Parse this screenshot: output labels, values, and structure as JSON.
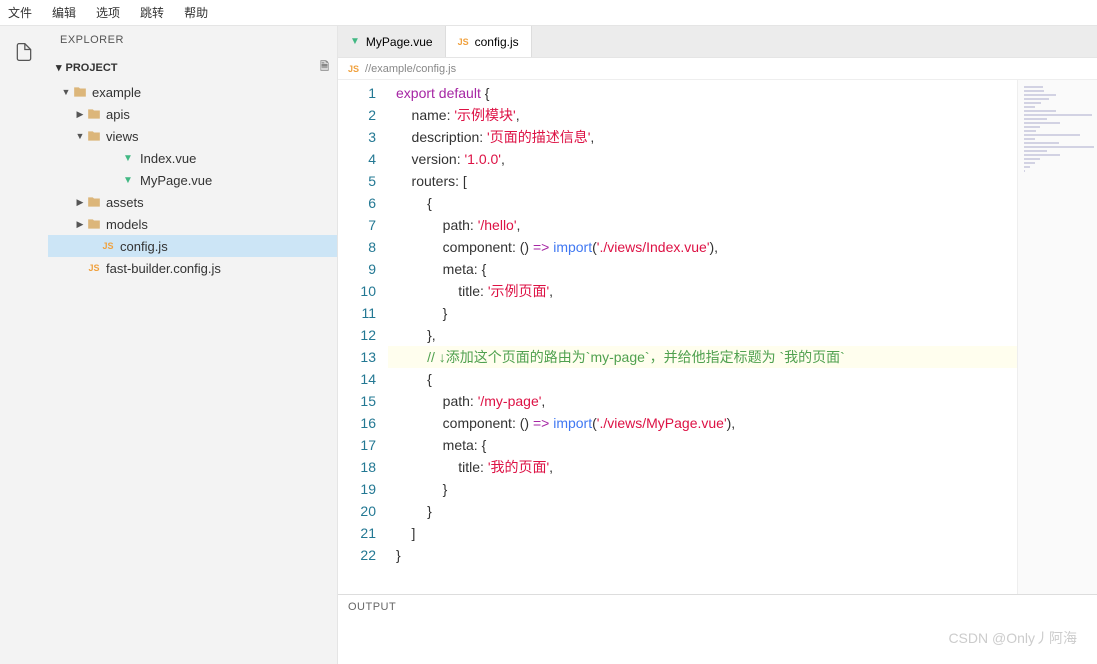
{
  "menubar": [
    "文件",
    "编辑",
    "选项",
    "跳转",
    "帮助"
  ],
  "sidebar": {
    "title": "EXPLORER",
    "project_label": "PROJECT",
    "tree": [
      {
        "label": "example",
        "indent": 0,
        "type": "folder",
        "expanded": true
      },
      {
        "label": "apis",
        "indent": 1,
        "type": "folder",
        "expanded": false
      },
      {
        "label": "views",
        "indent": 1,
        "type": "folder",
        "expanded": true
      },
      {
        "label": "Index.vue",
        "indent": 3,
        "type": "vue"
      },
      {
        "label": "MyPage.vue",
        "indent": 3,
        "type": "vue"
      },
      {
        "label": "assets",
        "indent": 1,
        "type": "folder",
        "expanded": false
      },
      {
        "label": "models",
        "indent": 1,
        "type": "folder",
        "expanded": false
      },
      {
        "label": "config.js",
        "indent": 2,
        "type": "js",
        "selected": true
      },
      {
        "label": "fast-builder.config.js",
        "indent": 1,
        "type": "js"
      }
    ]
  },
  "tabs": [
    {
      "label": "MyPage.vue",
      "icon": "vue",
      "active": false
    },
    {
      "label": "config.js",
      "icon": "js",
      "active": true
    }
  ],
  "breadcrumb": {
    "icon": "js",
    "path": "//example/config.js"
  },
  "code": {
    "lines": [
      [
        [
          "export default",
          "kw"
        ],
        [
          " {",
          "punc"
        ]
      ],
      [
        [
          "    name: ",
          "prop"
        ],
        [
          "'示例模块'",
          "str"
        ],
        [
          ",",
          "punc"
        ]
      ],
      [
        [
          "    description: ",
          "prop"
        ],
        [
          "'页面的描述信息'",
          "str"
        ],
        [
          ",",
          "punc"
        ]
      ],
      [
        [
          "    version: ",
          "prop"
        ],
        [
          "'1.0.0'",
          "str"
        ],
        [
          ",",
          "punc"
        ]
      ],
      [
        [
          "    routers: [",
          "prop"
        ]
      ],
      [
        [
          "        {",
          "punc"
        ]
      ],
      [
        [
          "            path: ",
          "prop"
        ],
        [
          "'/hello'",
          "str"
        ],
        [
          ",",
          "punc"
        ]
      ],
      [
        [
          "            component: ",
          "prop"
        ],
        [
          "()",
          "punc"
        ],
        [
          " => ",
          "kw"
        ],
        [
          "import",
          "fn"
        ],
        [
          "(",
          "punc"
        ],
        [
          "'./views/Index.vue'",
          "str"
        ],
        [
          "),",
          "punc"
        ]
      ],
      [
        [
          "            meta: {",
          "prop"
        ]
      ],
      [
        [
          "                title: ",
          "prop"
        ],
        [
          "'示例页面'",
          "str"
        ],
        [
          ",",
          "punc"
        ]
      ],
      [
        [
          "            }",
          "punc"
        ]
      ],
      [
        [
          "        },",
          "punc"
        ]
      ],
      [
        [
          "        // ↓添加这个页面的路由为`my-page`，并给他指定标题为 `我的页面`",
          "com"
        ]
      ],
      [
        [
          "        {",
          "punc"
        ]
      ],
      [
        [
          "            path: ",
          "prop"
        ],
        [
          "'/my-page'",
          "str"
        ],
        [
          ",",
          "punc"
        ]
      ],
      [
        [
          "            component: ",
          "prop"
        ],
        [
          "()",
          "punc"
        ],
        [
          " => ",
          "kw"
        ],
        [
          "import",
          "fn"
        ],
        [
          "(",
          "punc"
        ],
        [
          "'./views/MyPage.vue'",
          "str"
        ],
        [
          "),",
          "punc"
        ]
      ],
      [
        [
          "            meta: {",
          "prop"
        ]
      ],
      [
        [
          "                title: ",
          "prop"
        ],
        [
          "'我的页面'",
          "str"
        ],
        [
          ",",
          "punc"
        ]
      ],
      [
        [
          "            }",
          "punc"
        ]
      ],
      [
        [
          "        }",
          "punc"
        ]
      ],
      [
        [
          "    ]",
          "punc"
        ]
      ],
      [
        [
          "}",
          "punc"
        ]
      ]
    ],
    "highlight_line": 13
  },
  "output": {
    "title": "OUTPUT"
  },
  "watermark": "CSDN @Only丿阿海"
}
